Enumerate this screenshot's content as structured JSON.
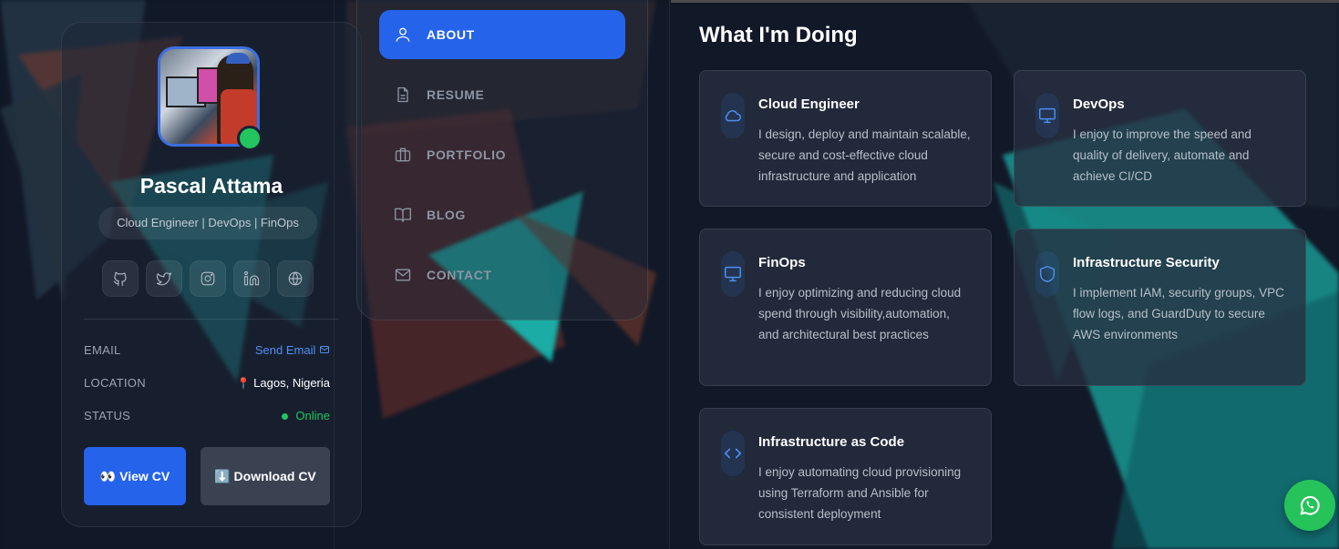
{
  "profile": {
    "name": "Pascal Attama",
    "title": "Cloud Engineer | DevOps | FinOps",
    "socials": [
      "github-icon",
      "twitter-icon",
      "instagram-icon",
      "linkedin-icon",
      "globe-icon"
    ],
    "email_label": "EMAIL",
    "email_value": "Send Email",
    "location_label": "LOCATION",
    "location_value": "Lagos, Nigeria",
    "location_pin": "📍",
    "status_label": "STATUS",
    "status_value": "Online",
    "view_cv": "👀 View CV",
    "download_cv": "⬇️ Download CV"
  },
  "nav": {
    "items": [
      {
        "label": "ABOUT",
        "icon": "user-icon",
        "active": true
      },
      {
        "label": "RESUME",
        "icon": "file-icon",
        "active": false
      },
      {
        "label": "PORTFOLIO",
        "icon": "briefcase-icon",
        "active": false
      },
      {
        "label": "BLOG",
        "icon": "book-icon",
        "active": false
      },
      {
        "label": "CONTACT",
        "icon": "mail-icon",
        "active": false
      }
    ]
  },
  "main": {
    "title": "What I'm Doing",
    "services": [
      {
        "title": "Cloud Engineer",
        "icon": "cloud-icon",
        "desc": "I design, deploy and maintain scalable, secure and cost-effective cloud infrastructure and application"
      },
      {
        "title": "DevOps",
        "icon": "monitor-icon",
        "desc": "I enjoy to improve the speed and quality of delivery, automate and achieve CI/CD"
      },
      {
        "title": "FinOps",
        "icon": "monitor-icon",
        "desc": "I enjoy optimizing and reducing cloud spend through visibility,automation, and architectural best practices"
      },
      {
        "title": "Infrastructure Security",
        "icon": "shield-icon",
        "desc": "I implement IAM, security groups, VPC flow logs, and GuardDuty to secure AWS environments"
      },
      {
        "title": "Infrastructure as Code",
        "icon": "code-icon",
        "desc": "I enjoy automating cloud provisioning using Terraform and Ansible for consistent deployment"
      }
    ]
  },
  "colors": {
    "accent": "#2563eb",
    "online": "#22c55e",
    "link": "#4d8ff0",
    "whatsapp": "#25c35a"
  },
  "floating": {
    "icon": "whatsapp-icon"
  }
}
